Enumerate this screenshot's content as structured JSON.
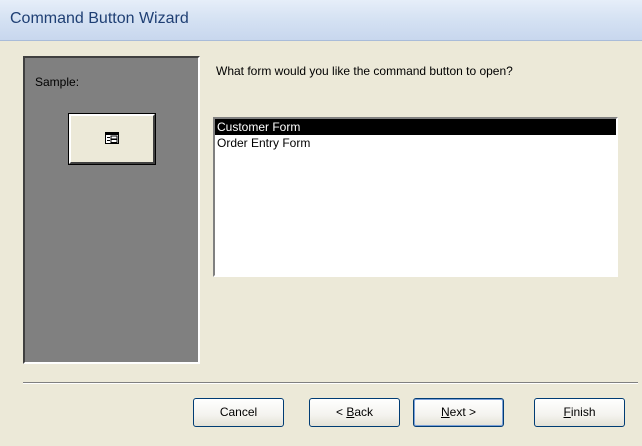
{
  "window": {
    "title": "Command Button Wizard"
  },
  "sample": {
    "label": "Sample:",
    "button_icon": "form-icon"
  },
  "prompt": "What form would you like the command button to open?",
  "forms": [
    {
      "label": "Customer Form",
      "selected": true
    },
    {
      "label": "Order Entry Form",
      "selected": false
    }
  ],
  "buttons": {
    "cancel": "Cancel",
    "back_prefix": "< ",
    "back_key": "B",
    "back_rest": "ack",
    "next_key": "N",
    "next_rest": "ext >",
    "finish_key": "F",
    "finish_rest": "inish"
  },
  "colors": {
    "selection": "#000000",
    "title_text": "#1f3f74",
    "panel": "#808080"
  }
}
